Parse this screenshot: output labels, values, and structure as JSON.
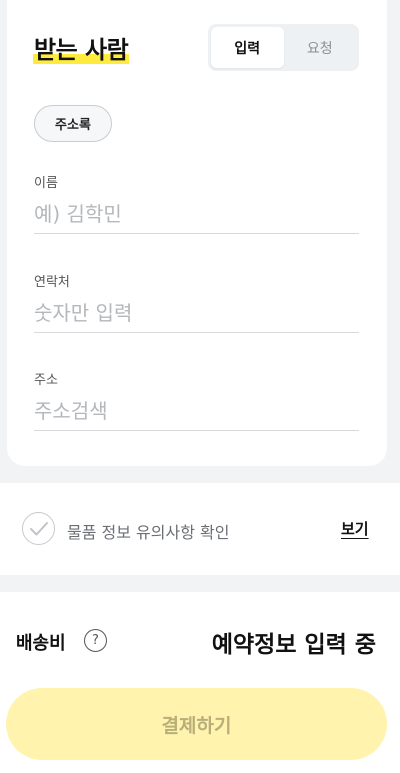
{
  "recipient": {
    "title": "받는 사람",
    "tabs": [
      {
        "label": "입력",
        "active": true
      },
      {
        "label": "요청",
        "active": false
      }
    ],
    "address_book_label": "주소록",
    "fields": {
      "name": {
        "label": "이름",
        "placeholder": "예) 김학민",
        "value": ""
      },
      "phone": {
        "label": "연락처",
        "placeholder": "숫자만 입력",
        "value": ""
      },
      "address": {
        "label": "주소",
        "placeholder": "주소검색",
        "value": ""
      }
    }
  },
  "notice": {
    "text": "물품 정보 유의사항 확인",
    "checked": false,
    "view_label": "보기"
  },
  "footer": {
    "shipping_label": "배송비",
    "help_glyph": "?",
    "status_text": "예약정보 입력 중",
    "pay_label": "결제하기"
  },
  "colors": {
    "highlight": "#ffeb3b",
    "pay_button_bg": "#fff3ae",
    "pay_button_text": "#b8ae7a",
    "page_bg": "#f2f3f5"
  },
  "icons": {
    "check": "check-icon",
    "help": "question-circle-icon"
  }
}
